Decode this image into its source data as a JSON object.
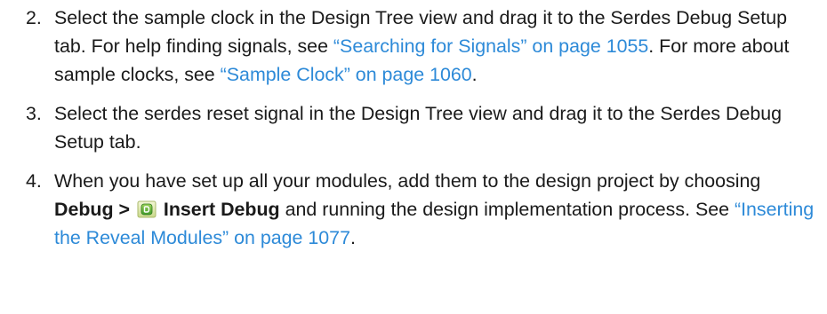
{
  "steps": [
    {
      "number": "2.",
      "text_1": "Select the sample clock in the Design Tree view and drag it to the Serdes Debug Setup tab. For help finding signals, see ",
      "link_1": "“Searching for Signals” on page 1055",
      "text_2": ". For more about sample clocks, see ",
      "link_2": "“Sample Clock” on page 1060",
      "text_3": "."
    },
    {
      "number": "3.",
      "text_1": "Select the serdes reset signal in the Design Tree view and drag it to the Serdes Debug Setup tab."
    },
    {
      "number": "4.",
      "text_1": "When you have set up all your modules, add them to the design project by choosing ",
      "menu": "Debug >",
      "icon": "insert-debug-icon",
      "command": "Insert Debug",
      "text_2": " and running the design implementation process. See ",
      "link_1": "“Inserting the Reveal Modules” on page 1077",
      "text_3": "."
    }
  ],
  "colors": {
    "link": "#2d8ad8",
    "text": "#1a1a1a"
  }
}
